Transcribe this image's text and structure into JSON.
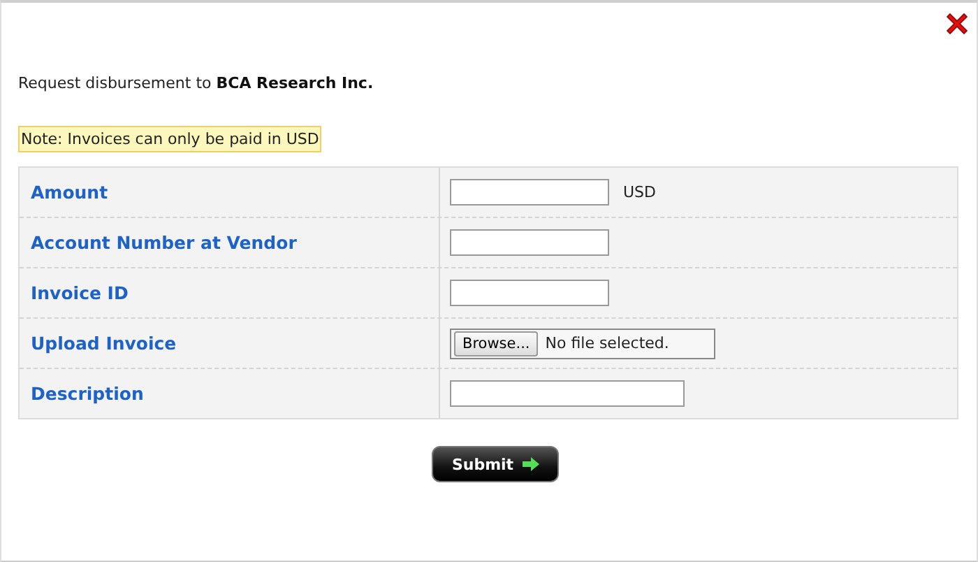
{
  "intro": "Request disbursement to **BCA Research Inc.**",
  "note": "Note: Invoices can only be paid in USD",
  "fields": [
    {
      "label": "Amount",
      "kind": "text",
      "unit": "USD"
    },
    {
      "label": "Account Number at Vendor",
      "kind": "text"
    },
    {
      "label": "Invoice ID",
      "kind": "text"
    },
    {
      "label": "Upload Invoice",
      "kind": "file",
      "button": "Browse...",
      "status": "No file selected."
    },
    {
      "label": "Description",
      "kind": "long-text"
    }
  ],
  "submit": "Submit"
}
